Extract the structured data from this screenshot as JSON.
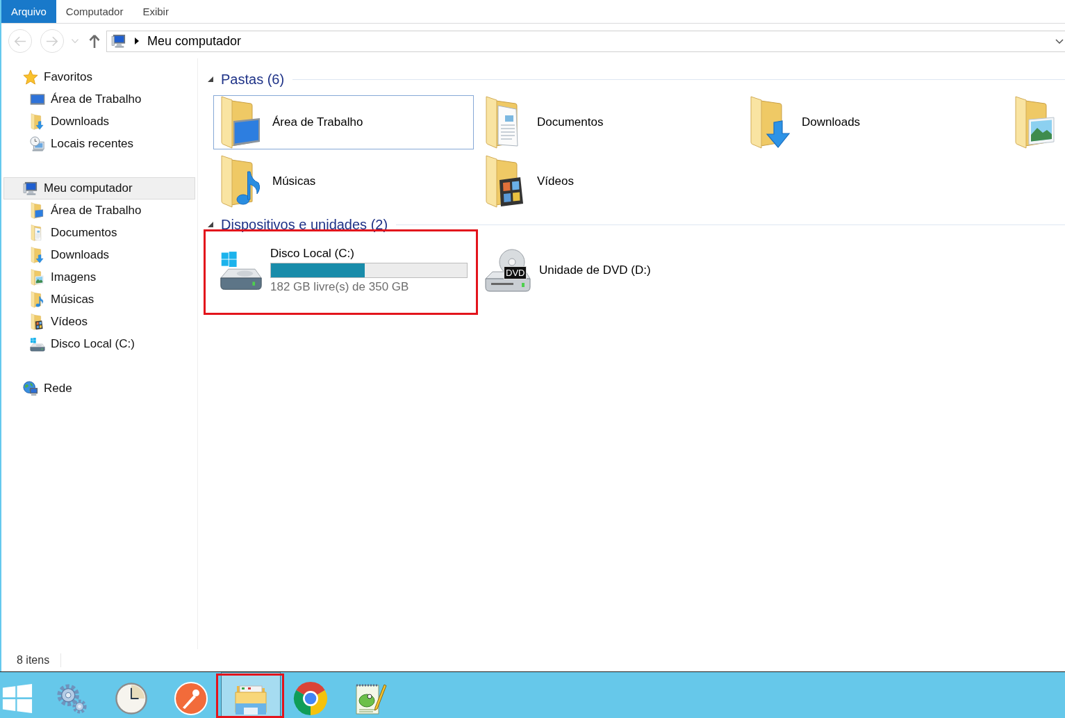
{
  "ribbon": {
    "tabs": [
      {
        "label": "Arquivo",
        "selected": true
      },
      {
        "label": "Computador",
        "selected": false
      },
      {
        "label": "Exibir",
        "selected": false
      }
    ]
  },
  "navigation": {
    "back": {
      "disabled": true
    },
    "forward": {
      "disabled": true
    },
    "history": {
      "disabled": true
    },
    "up": {
      "disabled": false
    },
    "address": {
      "path": [
        "Meu computador"
      ]
    }
  },
  "sidebar": {
    "groups": [
      {
        "label": "Favoritos",
        "kind": "favorites",
        "selected": false,
        "children": [
          {
            "label": "Área de Trabalho",
            "kind": "screen",
            "selected": false
          },
          {
            "label": "Downloads",
            "kind": "downloads",
            "selected": false
          },
          {
            "label": "Locais recentes",
            "kind": "recent",
            "selected": false
          }
        ]
      },
      {
        "label": "Meu computador",
        "kind": "computer",
        "selected": true,
        "children": [
          {
            "label": "Área de Trabalho",
            "kind": "desktop",
            "selected": false
          },
          {
            "label": "Documentos",
            "kind": "documents",
            "selected": false
          },
          {
            "label": "Downloads",
            "kind": "downloads",
            "selected": false
          },
          {
            "label": "Imagens",
            "kind": "pictures",
            "selected": false
          },
          {
            "label": "Músicas",
            "kind": "music",
            "selected": false
          },
          {
            "label": "Vídeos",
            "kind": "videos",
            "selected": false
          },
          {
            "label": "Disco Local (C:)",
            "kind": "disk",
            "selected": false
          }
        ]
      },
      {
        "label": "Rede",
        "kind": "network",
        "selected": false
      }
    ]
  },
  "content": {
    "sections": [
      {
        "title": "Pastas (6)",
        "expanded": true,
        "items": [
          {
            "label": "Área de Trabalho",
            "kind": "desktop",
            "selected": true
          },
          {
            "label": "Documentos",
            "kind": "documents",
            "selected": false
          },
          {
            "label": "Downloads",
            "kind": "downloads",
            "selected": false
          },
          {
            "kind": "pictures",
            "selected": false
          },
          {
            "label": "Músicas",
            "kind": "music",
            "selected": false
          },
          {
            "label": "Vídeos",
            "kind": "videos",
            "selected": false
          }
        ]
      },
      {
        "title": "Dispositivos e unidades (2)",
        "expanded": true,
        "items": [
          {
            "label": "Disco Local (C:)",
            "kind": "disk",
            "level": 0.48,
            "details": "182 GB livre(s) de 350 GB",
            "selected": false,
            "highlighted": true
          },
          {
            "label": "Unidade de DVD (D:)",
            "kind": "dvd",
            "badge": "DVD",
            "selected": false,
            "highlighted": false
          }
        ]
      }
    ]
  },
  "status_bar": {
    "item_count": "8 itens"
  },
  "taskbar": {
    "items": [
      {
        "kind": "start",
        "active": false,
        "highlighted": false
      },
      {
        "kind": "settings",
        "active": false,
        "highlighted": false
      },
      {
        "kind": "clock",
        "active": false,
        "highlighted": false
      },
      {
        "kind": "pen",
        "active": false,
        "highlighted": false
      },
      {
        "kind": "explorer",
        "active": true,
        "highlighted": true
      },
      {
        "kind": "browser",
        "active": false,
        "highlighted": false
      },
      {
        "kind": "notepad",
        "active": false,
        "highlighted": false
      }
    ]
  }
}
